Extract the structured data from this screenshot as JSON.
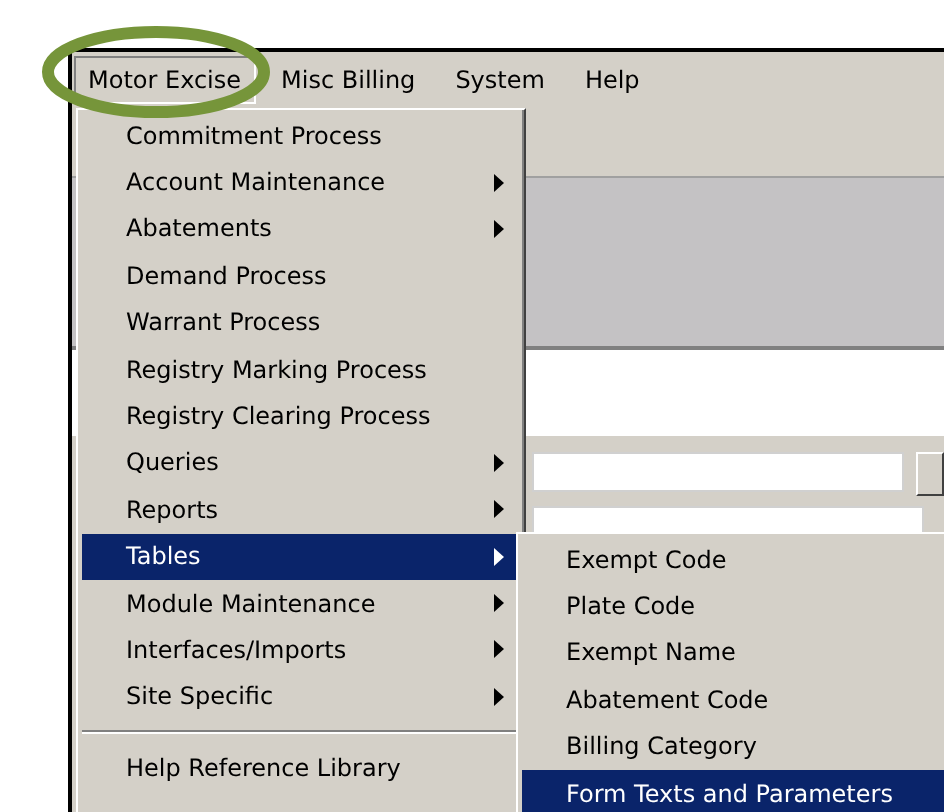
{
  "menubar": [
    {
      "label": "Motor Excise",
      "selected": true
    },
    {
      "label": "Misc Billing",
      "selected": false
    },
    {
      "label": "System",
      "selected": false
    },
    {
      "label": "Help",
      "selected": false
    }
  ],
  "menu": {
    "items": [
      {
        "kind": "item",
        "label": "Commitment Process",
        "selected": false
      },
      {
        "kind": "submenu",
        "label": "Account Maintenance",
        "selected": false
      },
      {
        "kind": "submenu",
        "label": "Abatements",
        "selected": false
      },
      {
        "kind": "item",
        "label": "Demand Process",
        "selected": false
      },
      {
        "kind": "item",
        "label": "Warrant Process",
        "selected": false
      },
      {
        "kind": "item",
        "label": "Registry Marking Process",
        "selected": false
      },
      {
        "kind": "item",
        "label": "Registry Clearing Process",
        "selected": false
      },
      {
        "kind": "submenu",
        "label": "Queries",
        "selected": false
      },
      {
        "kind": "submenu",
        "label": "Reports",
        "selected": false
      },
      {
        "kind": "submenu",
        "label": "Tables",
        "selected": true
      },
      {
        "kind": "submenu",
        "label": "Module Maintenance",
        "selected": false
      },
      {
        "kind": "submenu",
        "label": "Interfaces/Imports",
        "selected": false
      },
      {
        "kind": "submenu",
        "label": "Site Specific",
        "selected": false
      },
      {
        "kind": "separator"
      },
      {
        "kind": "item",
        "label": "Help Reference Library",
        "selected": false
      }
    ]
  },
  "submenu": {
    "items": [
      {
        "kind": "item",
        "label": "Exempt Code",
        "selected": false
      },
      {
        "kind": "item",
        "label": "Plate Code",
        "selected": false
      },
      {
        "kind": "item",
        "label": "Exempt Name",
        "selected": false
      },
      {
        "kind": "item",
        "label": "Abatement Code",
        "selected": false
      },
      {
        "kind": "item",
        "label": "Billing Category",
        "selected": false
      },
      {
        "kind": "item",
        "label": "Form Texts and Parameters",
        "selected": true
      }
    ]
  }
}
